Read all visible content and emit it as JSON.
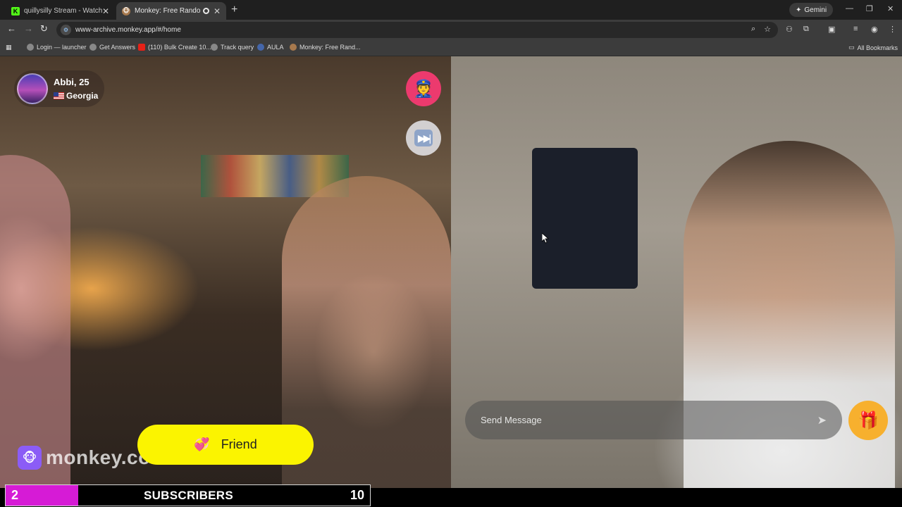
{
  "browser": {
    "tabs": [
      {
        "title": "quillysilly Stream - Watch Live o",
        "favicon": "kick-icon"
      },
      {
        "title": "Monkey: Free Random Vide",
        "favicon": "monkey-icon",
        "recording": true
      }
    ],
    "gemini_label": "Gemini",
    "url": "www-archive.monkey.app/#/home",
    "bookmarks": [
      {
        "label": "Login — launcher"
      },
      {
        "label": "Get Answers"
      },
      {
        "label": "(110) Bulk Create 10..."
      },
      {
        "label": "Track query"
      },
      {
        "label": "AULA"
      },
      {
        "label": "Monkey: Free Rand..."
      }
    ],
    "all_bookmarks_label": "All Bookmarks"
  },
  "stranger": {
    "name_age": "Abbi, 25",
    "location": "Georgia"
  },
  "friend_button_label": "Friend",
  "watermark_text": "monkey.co",
  "message": {
    "placeholder": "Send Message",
    "value": ""
  },
  "subscriber_goal": {
    "current": "2",
    "label": "SUBSCRIBERS",
    "goal": "10",
    "progress": 0.2,
    "fill_color": "#d61bd6"
  },
  "colors": {
    "friend_button": "#fbf400",
    "report_button": "#ec3a6e",
    "gift_button": "#f7b02e"
  },
  "icons": {
    "report": "police-officer-icon",
    "skip": "fast-forward-icon",
    "send": "send-arrow-icon",
    "gift": "gift-icon",
    "friend": "hearts-icon"
  }
}
